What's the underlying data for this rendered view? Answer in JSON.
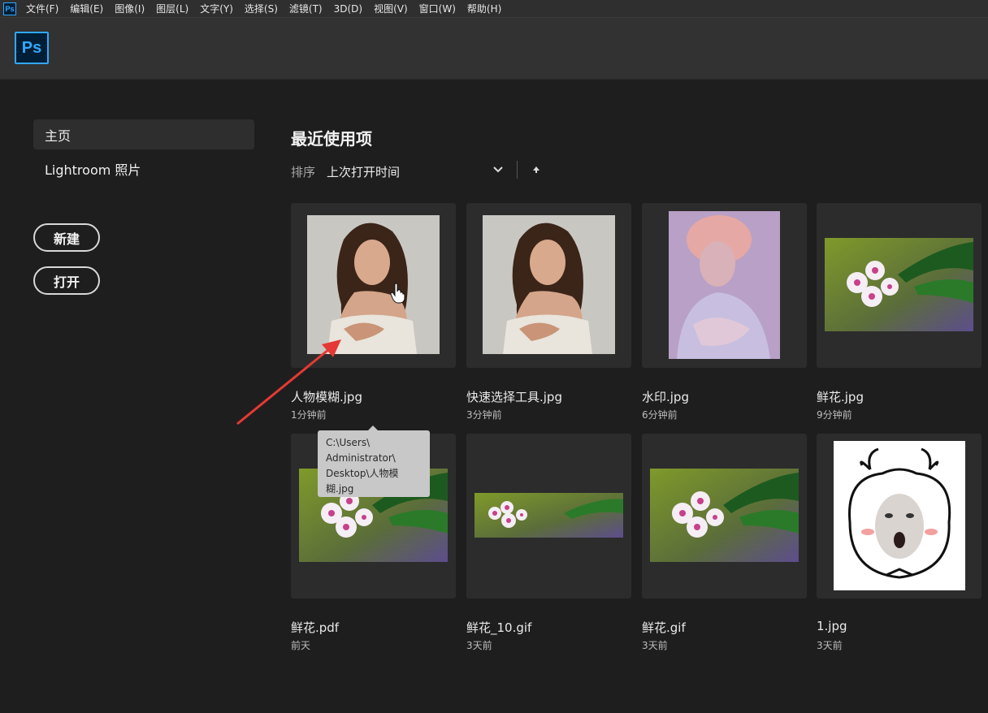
{
  "menubar": {
    "app_icon_text": "Ps",
    "items": [
      "文件(F)",
      "编辑(E)",
      "图像(I)",
      "图层(L)",
      "文字(Y)",
      "选择(S)",
      "滤镜(T)",
      "3D(D)",
      "视图(V)",
      "窗口(W)",
      "帮助(H)"
    ]
  },
  "header": {
    "logo_text": "Ps"
  },
  "sidebar": {
    "items": [
      {
        "label": "主页"
      },
      {
        "label": "Lightroom 照片"
      }
    ],
    "new_button": "新建",
    "open_button": "打开"
  },
  "main": {
    "title": "最近使用项",
    "sort_label": "排序",
    "sort_value": "上次打开时间",
    "files": [
      {
        "name": "人物模糊.jpg",
        "time": "1分钟前",
        "thumb": "portrait"
      },
      {
        "name": "快速选择工具.jpg",
        "time": "3分钟前",
        "thumb": "portrait"
      },
      {
        "name": "水印.jpg",
        "time": "6分钟前",
        "thumb": "painting"
      },
      {
        "name": "鲜花.jpg",
        "time": "9分钟前",
        "thumb": "flower"
      },
      {
        "name": "鲜花.pdf",
        "time": "前天",
        "thumb": "flower"
      },
      {
        "name": "鲜花_10.gif",
        "time": "3天前",
        "thumb": "flower-strip"
      },
      {
        "name": "鲜花.gif",
        "time": "3天前",
        "thumb": "flower"
      },
      {
        "name": "1.jpg",
        "time": "3天前",
        "thumb": "meme"
      }
    ]
  },
  "tooltip": {
    "lines": [
      "C:\\Users\\",
      "Administrator\\",
      "Desktop\\人物模",
      "糊.jpg"
    ]
  },
  "colors": {
    "accent": "#31a8ff",
    "background": "#1e1e1e",
    "annotation_arrow": "#e53935"
  }
}
